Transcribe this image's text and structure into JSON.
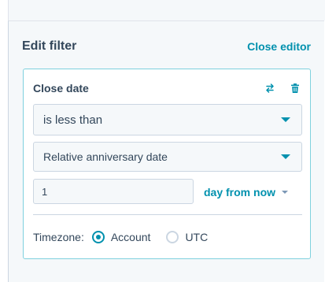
{
  "panel": {
    "title": "Edit filter",
    "close_label": "Close editor"
  },
  "filter": {
    "field_name": "Close date",
    "operator": "is less than",
    "value_type": "Relative anniversary date",
    "amount": "1",
    "unit": "day from now",
    "timezone": {
      "label": "Timezone:",
      "options": [
        {
          "label": "Account",
          "selected": true
        },
        {
          "label": "UTC",
          "selected": false
        }
      ]
    }
  },
  "colors": {
    "accent": "#0091ae",
    "text": "#33475b",
    "panel_bg": "#f5f8fa",
    "card_border": "#7fd1de"
  },
  "icons": [
    "swap-icon",
    "trash-icon",
    "chevron-down-icon"
  ]
}
